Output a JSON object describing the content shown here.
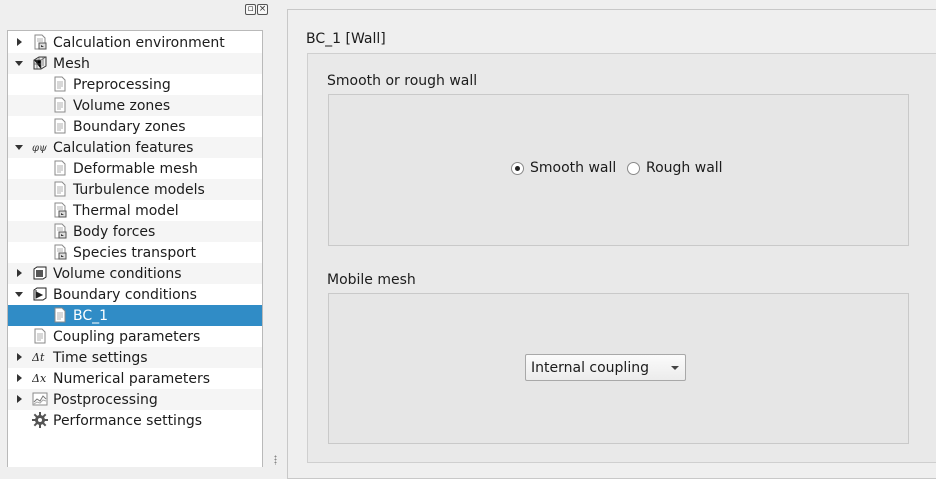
{
  "tree": {
    "items": [
      {
        "label": "Calculation environment",
        "icon": "document-arrow-icon",
        "level": 0,
        "arrow": "right"
      },
      {
        "label": "Mesh",
        "icon": "mesh-cube-icon",
        "level": 0,
        "arrow": "down"
      },
      {
        "label": "Preprocessing",
        "icon": "document-icon",
        "level": 1,
        "arrow": ""
      },
      {
        "label": "Volume zones",
        "icon": "document-icon",
        "level": 1,
        "arrow": ""
      },
      {
        "label": "Boundary zones",
        "icon": "document-icon",
        "level": 1,
        "arrow": ""
      },
      {
        "label": "Calculation features",
        "icon": "phi-psi-icon",
        "level": 0,
        "arrow": "down"
      },
      {
        "label": "Deformable mesh",
        "icon": "document-icon",
        "level": 1,
        "arrow": ""
      },
      {
        "label": "Turbulence models",
        "icon": "document-icon",
        "level": 1,
        "arrow": ""
      },
      {
        "label": "Thermal model",
        "icon": "document-arrow-icon",
        "level": 1,
        "arrow": ""
      },
      {
        "label": "Body forces",
        "icon": "document-arrow-icon",
        "level": 1,
        "arrow": ""
      },
      {
        "label": "Species transport",
        "icon": "document-arrow-icon",
        "level": 1,
        "arrow": ""
      },
      {
        "label": "Volume conditions",
        "icon": "volume-cube-icon",
        "level": 0,
        "arrow": "right"
      },
      {
        "label": "Boundary conditions",
        "icon": "boundary-arrow-icon",
        "level": 0,
        "arrow": "down"
      },
      {
        "label": "BC_1",
        "icon": "document-icon",
        "level": 1,
        "arrow": "",
        "selected": true
      },
      {
        "label": "Coupling parameters",
        "icon": "document-icon",
        "level": 0,
        "arrow": ""
      },
      {
        "label": "Time settings",
        "icon": "delta-t-icon",
        "level": 0,
        "arrow": "right"
      },
      {
        "label": "Numerical parameters",
        "icon": "delta-x-icon",
        "level": 0,
        "arrow": "right"
      },
      {
        "label": "Postprocessing",
        "icon": "chart-icon",
        "level": 0,
        "arrow": "right"
      },
      {
        "label": "Performance settings",
        "icon": "gear-icon",
        "level": 0,
        "arrow": ""
      }
    ]
  },
  "panel": {
    "title": "BC_1 [Wall]",
    "roughness": {
      "title": "Smooth or rough wall",
      "options": [
        {
          "label": "Smooth wall",
          "checked": true
        },
        {
          "label": "Rough wall",
          "checked": false
        }
      ]
    },
    "mobile_mesh": {
      "title": "Mobile mesh",
      "selected": "Internal coupling"
    }
  },
  "colors": {
    "selection": "#308cc6"
  }
}
